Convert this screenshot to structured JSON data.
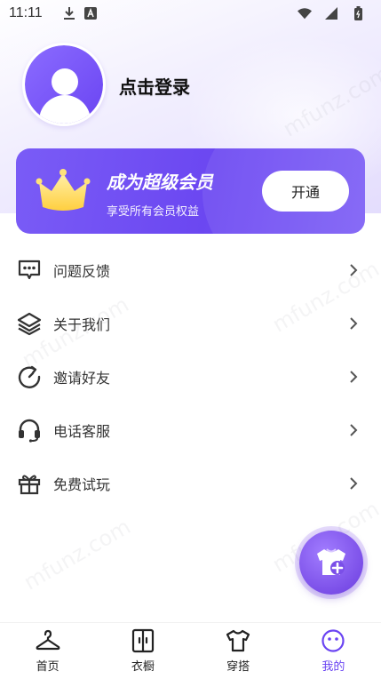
{
  "status_bar": {
    "time": "11:11"
  },
  "profile": {
    "login_text": "点击登录"
  },
  "vip": {
    "title": "成为超级会员",
    "subtitle": "享受所有会员权益",
    "button_label": "开通"
  },
  "menu": [
    {
      "label": "问题反馈",
      "icon": "feedback-icon"
    },
    {
      "label": "关于我们",
      "icon": "layers-icon"
    },
    {
      "label": "邀请好友",
      "icon": "refresh-icon"
    },
    {
      "label": "电话客服",
      "icon": "headset-icon"
    },
    {
      "label": "免费试玩",
      "icon": "gift-icon"
    }
  ],
  "watermark": "mfunz.com",
  "bottom_nav": [
    {
      "label": "首页",
      "icon": "hanger-icon"
    },
    {
      "label": "衣橱",
      "icon": "wardrobe-icon"
    },
    {
      "label": "穿搭",
      "icon": "tshirt-icon"
    },
    {
      "label": "我的",
      "icon": "smiley-icon",
      "active": true
    }
  ],
  "colors": {
    "accent": "#6a44f2",
    "vip_gradient_start": "#7a5cf6",
    "vip_gradient_end": "#6b47f1"
  }
}
